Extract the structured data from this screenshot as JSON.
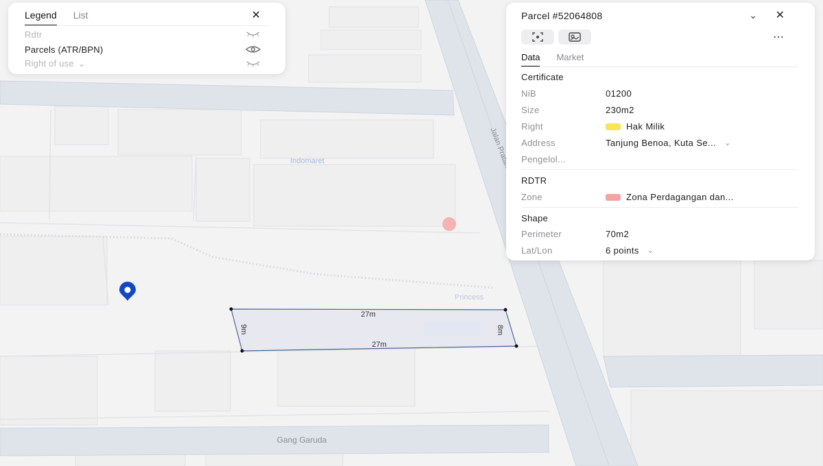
{
  "map": {
    "street_labels": [
      "Indomaret",
      "Jalan Pratama",
      "Princess",
      "Gang Garuda"
    ],
    "parcel_dimensions": {
      "top": "27m",
      "bottom": "27m",
      "left": "9m",
      "right": "8m"
    },
    "icons": [
      "location-pin-icon"
    ]
  },
  "legend": {
    "tabs": [
      "Legend",
      "List"
    ],
    "layers": [
      {
        "label": "Rdtr",
        "visibility_icon": "eye-closed-icon"
      },
      {
        "label": "Parcels (ATR/BPN)",
        "visibility_icon": "eye-open-icon"
      },
      {
        "label": "Right of use",
        "visibility_icon": "eye-closed-icon",
        "dropdown": "⌄"
      }
    ]
  },
  "parcel": {
    "title": "Parcel #52064808",
    "tabs": [
      "Data",
      "Market"
    ],
    "certificate": {
      "heading": "Certificate",
      "rows": [
        {
          "key": "NiB",
          "value": "01200"
        },
        {
          "key": "Size",
          "value": "230m2"
        },
        {
          "key": "Right",
          "value": "Hak Milik",
          "color": "#f8e55a"
        },
        {
          "key": "Address",
          "value": "Tanjung Benoa, Kuta Se..."
        },
        {
          "key": "Pengelol...",
          "value": ""
        }
      ]
    },
    "rdtr": {
      "heading": "RDTR",
      "zone_key": "Zone",
      "zone_value": "Zona Perdagangan dan...",
      "zone_color": "#f4a3a3"
    },
    "shape": {
      "heading": "Shape",
      "perimeter_key": "Perimeter",
      "perimeter_value": "70m2",
      "latlon_key": "Lat/Lon",
      "latlon_value": "6 points"
    }
  },
  "colors": {
    "accent": "#1a4fd6",
    "parcel_outline": "#3d5a8a",
    "road": "#dfe3ea"
  }
}
